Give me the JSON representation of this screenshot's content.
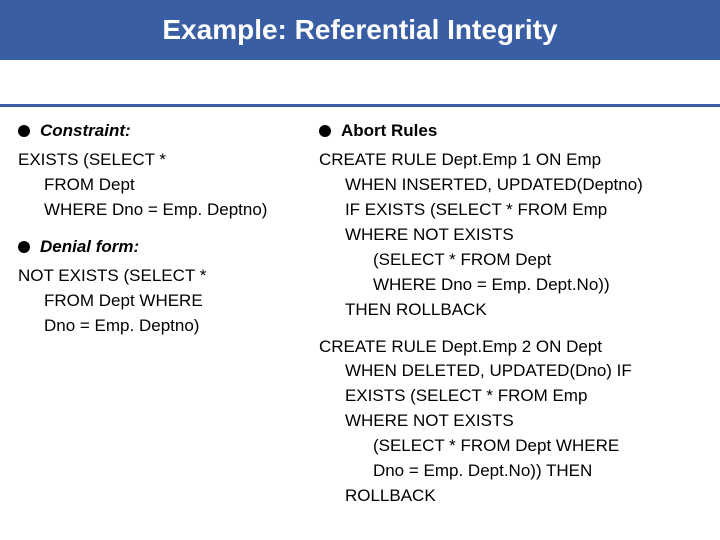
{
  "slide": {
    "title": "Example: Referential Integrity"
  },
  "left": {
    "heading1": "Constraint:",
    "block1": {
      "l1": "EXISTS (SELECT *",
      "l2": "FROM Dept",
      "l3": "WHERE Dno = Emp. Deptno)"
    },
    "heading2": "Denial form:",
    "block2": {
      "l1": "NOT EXISTS (SELECT *",
      "l2": "FROM Dept WHERE",
      "l3": "Dno = Emp. Deptno)"
    }
  },
  "right": {
    "heading": "Abort Rules",
    "rule1": {
      "l1": "CREATE RULE Dept.Emp 1 ON Emp",
      "l2": "WHEN INSERTED, UPDATED(Deptno)",
      "l3": "IF EXISTS (SELECT * FROM Emp",
      "l4": "WHERE NOT EXISTS",
      "l5": "(SELECT * FROM Dept",
      "l6": "WHERE Dno = Emp. Dept.No))",
      "l7": "THEN ROLLBACK"
    },
    "rule2": {
      "l1": "CREATE RULE Dept.Emp 2 ON Dept",
      "l2": "WHEN DELETED, UPDATED(Dno) IF",
      "l3": "EXISTS (SELECT * FROM Emp",
      "l4": "WHERE NOT EXISTS",
      "l5": "(SELECT * FROM Dept WHERE",
      "l6": "Dno = Emp. Dept.No)) THEN",
      "l7": "ROLLBACK"
    }
  }
}
